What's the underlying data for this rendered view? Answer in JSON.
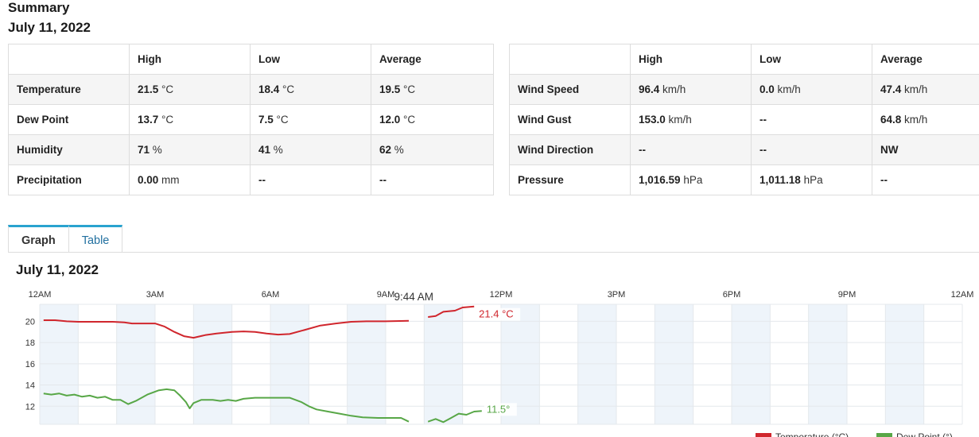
{
  "header": {
    "title": "Summary",
    "date": "July 11, 2022"
  },
  "summary_left": {
    "columns": [
      "",
      "High",
      "Low",
      "Average"
    ],
    "rows": [
      {
        "label": "Temperature",
        "high": "21.5",
        "high_unit": " °C",
        "low": "18.4",
        "low_unit": " °C",
        "avg": "19.5",
        "avg_unit": " °C"
      },
      {
        "label": "Dew Point",
        "high": "13.7",
        "high_unit": " °C",
        "low": "7.5",
        "low_unit": " °C",
        "avg": "12.0",
        "avg_unit": " °C"
      },
      {
        "label": "Humidity",
        "high": "71",
        "high_unit": " %",
        "low": "41",
        "low_unit": " %",
        "avg": "62",
        "avg_unit": " %"
      },
      {
        "label": "Precipitation",
        "high": "0.00",
        "high_unit": " mm",
        "low": "--",
        "low_unit": "",
        "avg": "--",
        "avg_unit": ""
      }
    ]
  },
  "summary_right": {
    "columns": [
      "",
      "High",
      "Low",
      "Average"
    ],
    "rows": [
      {
        "label": "Wind Speed",
        "high": "96.4",
        "high_unit": " km/h",
        "low": "0.0",
        "low_unit": " km/h",
        "avg": "47.4",
        "avg_unit": " km/h"
      },
      {
        "label": "Wind Gust",
        "high": "153.0",
        "high_unit": " km/h",
        "low": "--",
        "low_unit": "",
        "avg": "64.8",
        "avg_unit": " km/h"
      },
      {
        "label": "Wind Direction",
        "high": "--",
        "high_unit": "",
        "low": "--",
        "low_unit": "",
        "avg": "NW",
        "avg_unit": ""
      },
      {
        "label": "Pressure",
        "high": "1,016.59",
        "high_unit": " hPa",
        "low": "1,011.18",
        "low_unit": " hPa",
        "avg": "--",
        "avg_unit": ""
      }
    ]
  },
  "tabs": {
    "graph": "Graph",
    "table": "Table",
    "active": "Graph"
  },
  "chart_title": "July 11, 2022",
  "chart_data": {
    "type": "line",
    "title": "July 11, 2022",
    "x_ticks": [
      "12AM",
      "3AM",
      "6AM",
      "9AM",
      "12PM",
      "3PM",
      "6PM",
      "9PM",
      "12AM"
    ],
    "y_ticks": [
      12,
      14,
      16,
      18,
      20
    ],
    "ylim": [
      10.3,
      21.6
    ],
    "xlim_hours": [
      0,
      24
    ],
    "cursor_label": "9:44 AM",
    "grid": true,
    "legend_position": "bottom-right",
    "series": [
      {
        "name": "Temperature (°C)",
        "color": "#d0262d",
        "end_label": "21.4 °C",
        "segments": [
          [
            [
              0.1,
              20.1
            ],
            [
              0.4,
              20.1
            ],
            [
              0.7,
              20.0
            ],
            [
              1.0,
              19.95
            ],
            [
              1.3,
              19.95
            ],
            [
              1.6,
              19.95
            ],
            [
              1.9,
              19.95
            ],
            [
              2.2,
              19.9
            ],
            [
              2.4,
              19.8
            ],
            [
              2.7,
              19.8
            ],
            [
              3.0,
              19.8
            ],
            [
              3.25,
              19.5
            ],
            [
              3.5,
              19.0
            ],
            [
              3.75,
              18.6
            ],
            [
              4.0,
              18.45
            ],
            [
              4.3,
              18.7
            ],
            [
              4.6,
              18.85
            ],
            [
              5.0,
              19.0
            ],
            [
              5.3,
              19.05
            ],
            [
              5.6,
              19.0
            ],
            [
              5.9,
              18.85
            ],
            [
              6.2,
              18.75
            ],
            [
              6.5,
              18.8
            ],
            [
              6.9,
              19.2
            ],
            [
              7.3,
              19.6
            ],
            [
              7.7,
              19.8
            ],
            [
              8.1,
              19.95
            ],
            [
              8.5,
              20.0
            ],
            [
              9.0,
              20.0
            ],
            [
              9.6,
              20.05
            ]
          ],
          [
            [
              10.1,
              20.4
            ],
            [
              10.3,
              20.5
            ],
            [
              10.5,
              20.9
            ],
            [
              10.8,
              21.0
            ],
            [
              11.0,
              21.3
            ],
            [
              11.3,
              21.4
            ]
          ]
        ]
      },
      {
        "name": "Dew Point (°)",
        "color": "#58a747",
        "end_label": "11.5°",
        "segments": [
          [
            [
              0.1,
              13.2
            ],
            [
              0.3,
              13.1
            ],
            [
              0.5,
              13.2
            ],
            [
              0.7,
              13.0
            ],
            [
              0.9,
              13.1
            ],
            [
              1.1,
              12.9
            ],
            [
              1.3,
              13.0
            ],
            [
              1.5,
              12.8
            ],
            [
              1.7,
              12.9
            ],
            [
              1.9,
              12.6
            ],
            [
              2.1,
              12.6
            ],
            [
              2.3,
              12.2
            ],
            [
              2.5,
              12.5
            ],
            [
              2.8,
              13.1
            ],
            [
              3.1,
              13.5
            ],
            [
              3.3,
              13.6
            ],
            [
              3.5,
              13.5
            ],
            [
              3.65,
              13.0
            ],
            [
              3.8,
              12.4
            ],
            [
              3.9,
              11.8
            ],
            [
              4.0,
              12.3
            ],
            [
              4.2,
              12.6
            ],
            [
              4.5,
              12.6
            ],
            [
              4.7,
              12.5
            ],
            [
              4.9,
              12.6
            ],
            [
              5.1,
              12.5
            ],
            [
              5.3,
              12.7
            ],
            [
              5.6,
              12.8
            ],
            [
              5.9,
              12.8
            ],
            [
              6.2,
              12.8
            ],
            [
              6.5,
              12.8
            ],
            [
              6.8,
              12.4
            ],
            [
              7.0,
              12.0
            ],
            [
              7.2,
              11.7
            ],
            [
              7.5,
              11.5
            ],
            [
              7.8,
              11.3
            ],
            [
              8.1,
              11.1
            ],
            [
              8.4,
              10.95
            ],
            [
              8.8,
              10.9
            ],
            [
              9.1,
              10.9
            ],
            [
              9.4,
              10.9
            ],
            [
              9.6,
              10.55
            ]
          ],
          [
            [
              10.1,
              10.55
            ],
            [
              10.3,
              10.8
            ],
            [
              10.5,
              10.5
            ],
            [
              10.7,
              10.9
            ],
            [
              10.9,
              11.3
            ],
            [
              11.1,
              11.2
            ],
            [
              11.3,
              11.5
            ],
            [
              11.5,
              11.55
            ]
          ]
        ]
      }
    ]
  }
}
